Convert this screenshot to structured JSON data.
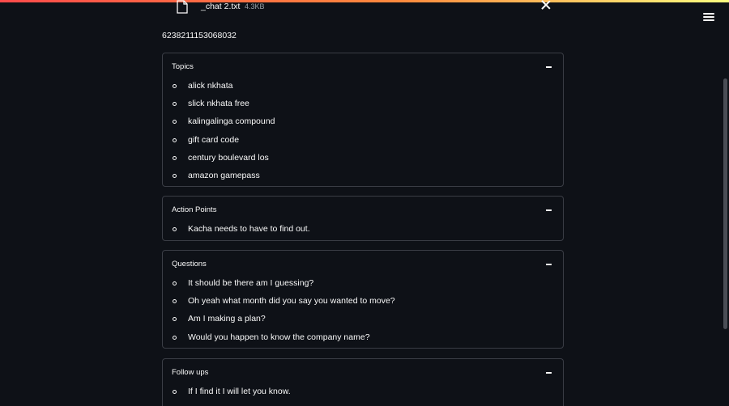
{
  "file": {
    "name": "_chat 2.txt",
    "size": "4.3KB"
  },
  "doc_id": "6238211153068032",
  "sections": [
    {
      "title": "Topics",
      "items": [
        "alick nkhata",
        "slick nkhata free",
        "kalingalinga compound",
        "gift card code",
        "century boulevard los",
        "amazon gamepass"
      ]
    },
    {
      "title": "Action Points",
      "items": [
        "Kacha needs to have to find out."
      ]
    },
    {
      "title": "Questions",
      "items": [
        "It should be there am I guessing?",
        "Oh yeah what month did you say you wanted to move?",
        "Am I making a plan?",
        "Would you happen to know the company name?"
      ]
    },
    {
      "title": "Follow ups",
      "items": [
        "If I find it I will let you know."
      ]
    }
  ],
  "icons": {
    "file": "file-icon",
    "close": "close-icon",
    "menu": "hamburger-menu-icon",
    "collapse": "collapse-icon",
    "bullet": "bullet-icon"
  },
  "colors": {
    "background": "#0e1117",
    "text": "#fafafa",
    "border": "#3a3d45",
    "accent": "#ff4b4b"
  }
}
